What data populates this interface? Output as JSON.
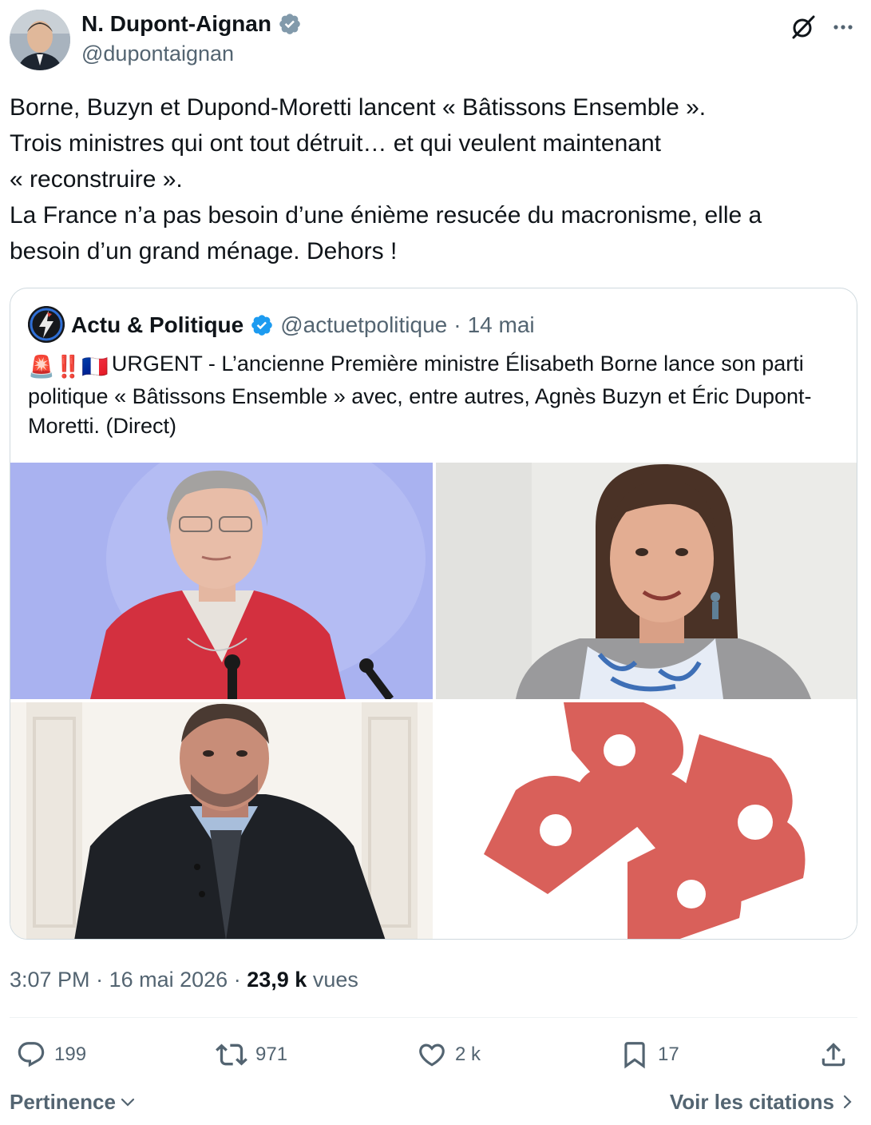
{
  "author": {
    "name": "N. Dupont-Aignan",
    "handle": "@dupontaignan"
  },
  "tweet": {
    "text": "Borne, Buzyn et Dupond-Moretti lancent « Bâtissons Ensemble ».\nTrois ministres qui ont tout détruit… et qui veulent maintenant\n« reconstruire ».\nLa France n’a pas besoin d’une énième resucée du macronisme, elle a\nbesoin d’un grand ménage. Dehors !"
  },
  "quoted": {
    "name": "Actu & Politique",
    "handle": "@actuetpolitique",
    "separator": "·",
    "date": "14 mai",
    "emojis": "🚨‼️🇫🇷",
    "text": "URGENT - L’ancienne Première ministre Élisabeth Borne lance son parti politique « Bâtissons Ensemble » avec, entre autres, Agnès Buzyn et Éric Dupont-Moretti. (Direct)"
  },
  "meta": {
    "time": "3:07 PM",
    "separator": "·",
    "date": "16 mai 2026",
    "views_count": "23,9 k",
    "views_label": "vues"
  },
  "actions": {
    "replies": "199",
    "retweets": "971",
    "likes": "2 k",
    "bookmarks": "17"
  },
  "footer": {
    "sort_label": "Pertinence",
    "quotes_label": "Voir les citations"
  },
  "colors": {
    "text_primary": "#0f1419",
    "text_secondary": "#536471",
    "verified_blue": "#1d9bf0",
    "border": "#cfd9de",
    "logo_red": "#d9605a"
  },
  "icons": [
    "verified-badge-icon",
    "grok-icon",
    "more-icon",
    "lightning-icon",
    "reply-icon",
    "retweet-icon",
    "like-icon",
    "bookmark-icon",
    "share-icon",
    "chevron-down-icon",
    "chevron-right-icon"
  ]
}
